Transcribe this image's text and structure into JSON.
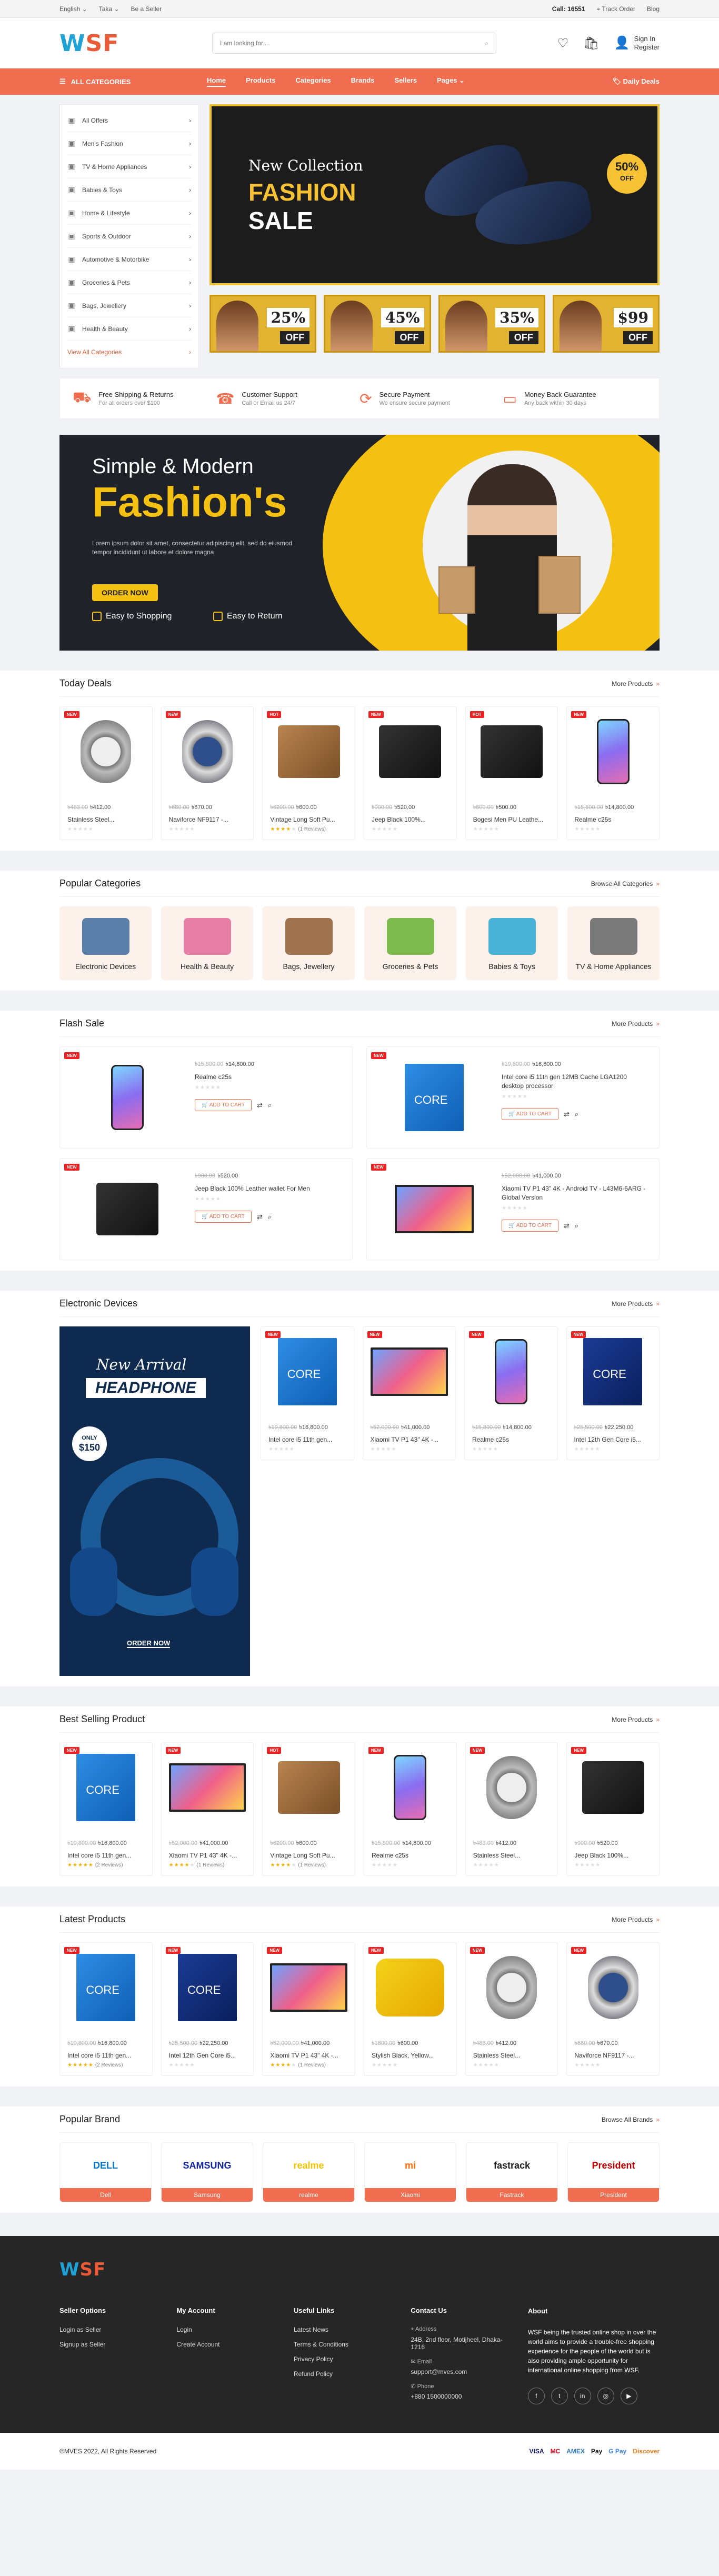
{
  "topbar": {
    "language": "English",
    "currency": "Taka",
    "seller": "Be a Seller",
    "call_label": "Call:",
    "call_number": "16551",
    "track": "Track Order",
    "blog": "Blog"
  },
  "header": {
    "logo_a": "W",
    "logo_b": "SF",
    "search_placeholder": "I am looking for....",
    "sign_in": "Sign In",
    "register": "Register"
  },
  "nav": {
    "all_categories": "ALL CATEGORIES",
    "links": [
      "Home",
      "Products",
      "Categories",
      "Brands",
      "Sellers",
      "Pages"
    ],
    "daily_deals": "Daily Deals"
  },
  "categories": [
    {
      "label": "All Offers",
      "icon": "tag-icon"
    },
    {
      "label": "Men's Fashion",
      "icon": "shirt-icon"
    },
    {
      "label": "TV & Home Appliances",
      "icon": "tv-icon"
    },
    {
      "label": "Babies & Toys",
      "icon": "toy-icon"
    },
    {
      "label": "Home & Lifestyle",
      "icon": "home-icon"
    },
    {
      "label": "Sports & Outdoor",
      "icon": "ball-icon"
    },
    {
      "label": "Automotive & Motorbike",
      "icon": "car-icon"
    },
    {
      "label": "Groceries & Pets",
      "icon": "basket-icon"
    },
    {
      "label": "Bags, Jewellery",
      "icon": "bag-icon"
    },
    {
      "label": "Health & Beauty",
      "icon": "heart-icon"
    },
    {
      "label": "View All Categories",
      "icon": "arrow-icon"
    }
  ],
  "hero": {
    "line1": "New Collection",
    "line2": "FASHION",
    "line3": "SALE",
    "badge_pct": "50%",
    "badge_off": "OFF"
  },
  "promos": [
    {
      "pct": "25%",
      "off": "OFF"
    },
    {
      "pct": "45%",
      "off": "OFF"
    },
    {
      "pct": "35%",
      "off": "OFF"
    },
    {
      "pct": "$99",
      "off": "OFF"
    }
  ],
  "features": [
    {
      "title": "Free Shipping & Returns",
      "sub": "For all orders over $100",
      "icon": "truck-icon"
    },
    {
      "title": "Customer Support",
      "sub": "Call or Email us 24/7",
      "icon": "headset-icon"
    },
    {
      "title": "Secure Payment",
      "sub": "We ensure secure payment",
      "icon": "refresh-icon"
    },
    {
      "title": "Money Back Guarantee",
      "sub": "Any back within 30 days",
      "icon": "card-icon"
    }
  ],
  "banner": {
    "line1": "Simple & Modern",
    "line2": "Fashion's",
    "text": "Lorem ipsum dolor sit amet, consectetur adipiscing elit, sed do eiusmod tempor incididunt ut labore et dolore magna",
    "button": "ORDER NOW",
    "b1": "Easy to Shopping",
    "b2": "Easy to Return"
  },
  "today": {
    "title": "Today Deals",
    "more": "More Products",
    "items": [
      {
        "tag": "NEW",
        "old": "৳483.00",
        "price": "৳412.00",
        "name": "Stainless Steel...",
        "img": "watch",
        "stars": 0,
        "reviews": ""
      },
      {
        "tag": "NEW",
        "old": "৳680.00",
        "price": "৳670.00",
        "name": "Naviforce NF9117 -...",
        "img": "watch-blue",
        "stars": 0,
        "reviews": ""
      },
      {
        "tag": "HOT",
        "old": "৳6200.00",
        "price": "৳600.00",
        "name": "Vintage Long Soft Pu...",
        "img": "wallet",
        "stars": 4,
        "reviews": "(1 Reviews)"
      },
      {
        "tag": "NEW",
        "old": "৳900.00",
        "price": "৳520.00",
        "name": "Jeep Black 100%...",
        "img": "wallet-dark",
        "stars": 0,
        "reviews": ""
      },
      {
        "tag": "HOT",
        "old": "৳600.00",
        "price": "৳500.00",
        "name": "Bogesi Men PU Leathe...",
        "img": "wallet-dark",
        "stars": 0,
        "reviews": ""
      },
      {
        "tag": "NEW",
        "old": "৳15,800.00",
        "price": "৳14,800.00",
        "name": "Realme c25s",
        "img": "phone",
        "stars": 0,
        "reviews": ""
      }
    ]
  },
  "popular": {
    "title": "Popular Categories",
    "more": "Browse All Categories",
    "items": [
      {
        "label": "Electronic Devices",
        "color": "#5b7fa8"
      },
      {
        "label": "Health & Beauty",
        "color": "#e77fa4"
      },
      {
        "label": "Bags, Jewellery",
        "color": "#a0734f"
      },
      {
        "label": "Groceries & Pets",
        "color": "#7dbb4e"
      },
      {
        "label": "Babies & Toys",
        "color": "#49b3d6"
      },
      {
        "label": "TV & Home Appliances",
        "color": "#7a7a7a"
      }
    ]
  },
  "flash": {
    "title": "Flash Sale",
    "more": "More Products",
    "add_to_cart": "ADD TO CART",
    "items": [
      {
        "tag": "NEW",
        "old": "৳15,800.00",
        "price": "৳14,800.00",
        "name": "Realme c25s",
        "img": "phone"
      },
      {
        "tag": "NEW",
        "old": "৳19,800.00",
        "price": "৳16,800.00",
        "name": "Intel core i5 11th gen 12MB Cache LGA1200 desktop processor",
        "img": "box"
      },
      {
        "tag": "NEW",
        "old": "৳900.00",
        "price": "৳520.00",
        "name": "Jeep Black 100% Leather wallet For Men",
        "img": "wallet-dark"
      },
      {
        "tag": "NEW",
        "old": "৳52,000.00",
        "price": "৳41,000.00",
        "name": "Xiaomi TV P1 43\" 4K - Android TV - L43M6-6ARG - Global Version",
        "img": "tv"
      }
    ]
  },
  "electronic": {
    "title": "Electronic Devices",
    "more": "More Products",
    "promo": {
      "new_arrival": "New Arrival",
      "headphone": "HEADPHONE",
      "only": "ONLY",
      "price": "$150",
      "order": "ORDER NOW"
    },
    "items": [
      {
        "tag": "NEW",
        "old": "৳19,800.00",
        "price": "৳16,800.00",
        "name": "Intel core i5 11th gen...",
        "img": "box"
      },
      {
        "tag": "NEW",
        "old": "৳52,000.00",
        "price": "৳41,000.00",
        "name": "Xiaomi TV P1 43\" 4K -...",
        "img": "tv"
      },
      {
        "tag": "NEW",
        "old": "৳15,800.00",
        "price": "৳14,800.00",
        "name": "Realme c25s",
        "img": "phone"
      },
      {
        "tag": "NEW",
        "old": "৳25,500.00",
        "price": "৳22,250.00",
        "name": "Intel 12th Gen Core i5...",
        "img": "box-dark"
      }
    ]
  },
  "best": {
    "title": "Best Selling Product",
    "more": "More Products",
    "items": [
      {
        "tag": "NEW",
        "old": "৳19,800.00",
        "price": "৳16,800.00",
        "name": "Intel core i5 11th gen...",
        "img": "box",
        "stars": 5,
        "reviews": "(2 Reviews)"
      },
      {
        "tag": "NEW",
        "old": "৳52,000.00",
        "price": "৳41,000.00",
        "name": "Xiaomi TV P1 43\" 4K -...",
        "img": "tv",
        "stars": 4,
        "reviews": "(1 Reviews)"
      },
      {
        "tag": "HOT",
        "old": "৳6200.00",
        "price": "৳600.00",
        "name": "Vintage Long Soft Pu...",
        "img": "wallet",
        "stars": 4,
        "reviews": "(1 Reviews)"
      },
      {
        "tag": "NEW",
        "old": "৳15,800.00",
        "price": "৳14,800.00",
        "name": "Realme c25s",
        "img": "phone",
        "stars": 0,
        "reviews": ""
      },
      {
        "tag": "NEW",
        "old": "৳483.00",
        "price": "৳412.00",
        "name": "Stainless Steel...",
        "img": "watch",
        "stars": 0,
        "reviews": ""
      },
      {
        "tag": "NEW",
        "old": "৳900.00",
        "price": "৳520.00",
        "name": "Jeep Black 100%...",
        "img": "wallet-dark",
        "stars": 0,
        "reviews": ""
      }
    ]
  },
  "latest": {
    "title": "Latest Products",
    "more": "More Products",
    "items": [
      {
        "tag": "NEW",
        "old": "৳19,800.00",
        "price": "৳16,800.00",
        "name": "Intel core i5 11th gen...",
        "img": "box",
        "stars": 5,
        "reviews": "(2 Reviews)"
      },
      {
        "tag": "NEW",
        "old": "৳25,500.00",
        "price": "৳22,250.00",
        "name": "Intel 12th Gen Core i5...",
        "img": "box-dark",
        "stars": 0,
        "reviews": ""
      },
      {
        "tag": "NEW",
        "old": "৳52,000.00",
        "price": "৳41,000.00",
        "name": "Xiaomi TV P1 43\" 4K -...",
        "img": "tv",
        "stars": 4,
        "reviews": "(1 Reviews)"
      },
      {
        "tag": "NEW",
        "old": "৳1800.00",
        "price": "৳600.00",
        "name": "Stylish Black, Yellow...",
        "img": "sandal",
        "stars": 0,
        "reviews": ""
      },
      {
        "tag": "NEW",
        "old": "৳483.00",
        "price": "৳412.00",
        "name": "Stainless Steel...",
        "img": "watch",
        "stars": 0,
        "reviews": ""
      },
      {
        "tag": "NEW",
        "old": "৳680.00",
        "price": "৳670.00",
        "name": "Naviforce NF9117 -...",
        "img": "watch-blue",
        "stars": 0,
        "reviews": ""
      }
    ]
  },
  "brands": {
    "title": "Popular Brand",
    "more": "Browse All Brands",
    "items": [
      {
        "name": "Dell",
        "logo": "DELL",
        "color": "#0076ce"
      },
      {
        "name": "Samsung",
        "logo": "SAMSUNG",
        "color": "#1428a0"
      },
      {
        "name": "realme",
        "logo": "realme",
        "color": "#f5c400"
      },
      {
        "name": "Xiaomi",
        "logo": "mi",
        "color": "#ff6900"
      },
      {
        "name": "Fastrack",
        "logo": "fastrack",
        "color": "#222222"
      },
      {
        "name": "President",
        "logo": "President",
        "color": "#c00000"
      }
    ]
  },
  "footer": {
    "col1": {
      "title": "Seller Options",
      "links": [
        "Login as Seller",
        "Signup as Seller"
      ]
    },
    "col2": {
      "title": "My Account",
      "links": [
        "Login",
        "Create Account"
      ]
    },
    "col3": {
      "title": "Useful Links",
      "links": [
        "Latest News",
        "Terms & Conditions",
        "Privacy Policy",
        "Refund Policy"
      ]
    },
    "contact": {
      "title": "Contact Us",
      "address_label": "Address",
      "address": "24B, 2nd floor, Motijheel, Dhaka-1216",
      "email_label": "Email",
      "email": "support@mves.com",
      "phone_label": "Phone",
      "phone": "+880 1500000000"
    },
    "about": {
      "title": "About",
      "text": "WSF being the trusted online shop in over the world aims to provide a trouble-free shopping experience for the people of the world but is also providing ample opportunity for international online shopping from WSF."
    },
    "copyright": "©MVES 2022, All Rights Reserved",
    "payments": [
      "VISA",
      "MC",
      "AMEX",
      "Pay",
      "G Pay",
      "Discover"
    ]
  }
}
